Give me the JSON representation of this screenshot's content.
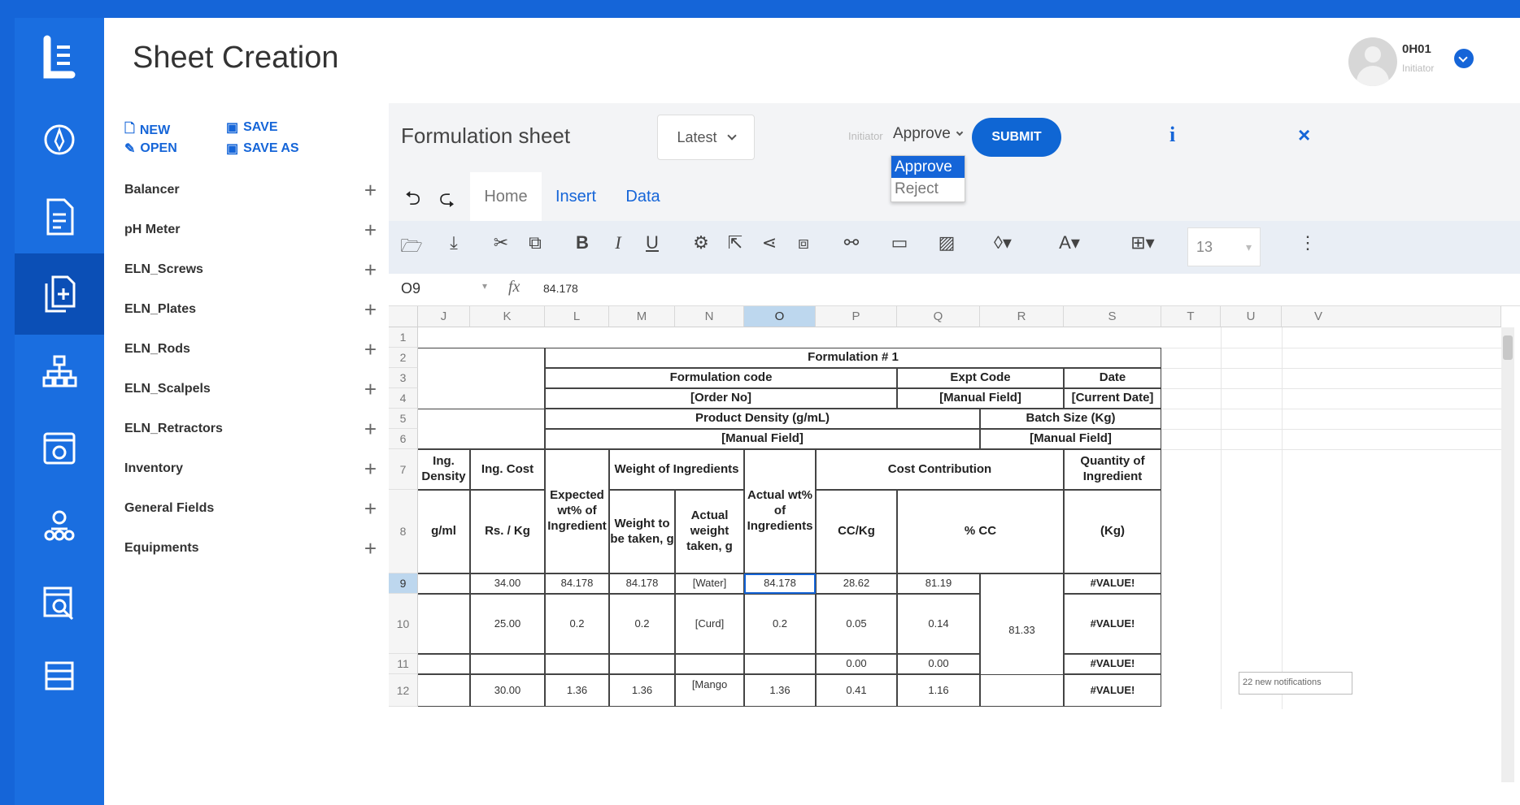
{
  "header": {
    "title": "Sheet Creation",
    "user": {
      "name": "0H01",
      "role": "Initiator"
    }
  },
  "rail": {
    "icons": [
      "logo-icon",
      "compass-icon",
      "document-icon",
      "copy-add-icon",
      "hierarchy-icon",
      "gear-window-icon",
      "team-icon",
      "search-document-icon",
      "list-icon"
    ]
  },
  "file_actions": {
    "new": "NEW",
    "open": "OPEN",
    "save": "SAVE",
    "save_as": "SAVE AS"
  },
  "sidebar": {
    "items": [
      {
        "label": "Balancer"
      },
      {
        "label": "pH Meter"
      },
      {
        "label": "ELN_Screws"
      },
      {
        "label": "ELN_Plates"
      },
      {
        "label": "ELN_Rods"
      },
      {
        "label": "ELN_Scalpels"
      },
      {
        "label": "ELN_Retractors"
      },
      {
        "label": "Inventory"
      },
      {
        "label": "General Fields"
      },
      {
        "label": "Equipments"
      }
    ]
  },
  "sheet": {
    "title": "Formulation sheet",
    "version": "Latest",
    "status_label": "Initiator",
    "action_selected": "Approve",
    "action_options": [
      "Approve",
      "Reject"
    ],
    "submit": "SUBMIT",
    "info": "i",
    "close": "×"
  },
  "tabs": [
    "Home",
    "Insert",
    "Data"
  ],
  "font_size": "13",
  "formula_bar": {
    "cell": "O9",
    "fx": "fx",
    "value": "84.178"
  },
  "grid": {
    "columns": [
      "J",
      "K",
      "L",
      "M",
      "N",
      "O",
      "P",
      "Q",
      "R",
      "S",
      "T",
      "U",
      "V"
    ],
    "rows": [
      "1",
      "2",
      "3",
      "4",
      "5",
      "6",
      "7",
      "8",
      "9",
      "10",
      "11",
      "12"
    ],
    "selected_column": "O",
    "selected_row": "9",
    "cells": {
      "title": "Formulation # 1",
      "formulation_code": "Formulation code",
      "expt_code": "Expt Code",
      "date": "Date",
      "order_no": "[Order No]",
      "manual_field_1": "[Manual Field]",
      "current_date": "[Current Date]",
      "product_density": "Product Density (g/mL)",
      "batch_size": "Batch Size (Kg)",
      "manual_field_2": "[Manual Field]",
      "manual_field_3": "[Manual Field]",
      "ing_density": "Ing. Density",
      "ing_cost": "Ing. Cost",
      "expected_wt": "Expected wt% of Ingredient",
      "weight_of_ingredients": "Weight of Ingredients",
      "actual_wt": "Actual wt% of Ingredients",
      "cost_contribution": "Cost Contribution",
      "quantity_of_ingredient": "Quantity of Ingredient",
      "g_ml": "g/ml",
      "rs_kg": "Rs. / Kg",
      "weight_to_be_taken": "Weight to be taken, g",
      "actual_weight_taken": "Actual weight taken, g",
      "cc_kg": "CC/Kg",
      "pct_cc": "% CC",
      "kg": "(Kg)",
      "r9_k": "34.00",
      "r9_l": "84.178",
      "r9_m": "84.178",
      "r9_n": "[Water]",
      "r9_o": "84.178",
      "r9_p": "28.62",
      "r9_q": "81.19",
      "r9_s": "#VALUE!",
      "r10_k": "25.00",
      "r10_l": "0.2",
      "r10_m": "0.2",
      "r10_n": "[Curd]",
      "r10_o": "0.2",
      "r10_p": "0.05",
      "r10_q": "0.14",
      "r10_r": "81.33",
      "r10_s": "#VALUE!",
      "r11_p": "0.00",
      "r11_q": "0.00",
      "r11_s": "#VALUE!",
      "r12_k": "30.00",
      "r12_l": "1.36",
      "r12_m": "1.36",
      "r12_n": "[Mango",
      "r12_o": "1.36",
      "r12_p": "0.41",
      "r12_q": "1.16",
      "r12_s": "#VALUE!"
    }
  },
  "toast": "22 new notifications",
  "colors": {
    "primary": "#1565d8",
    "rail": "#1a6ee0",
    "rail_active": "#0b4fb6",
    "selection": "#bdd7ee"
  }
}
